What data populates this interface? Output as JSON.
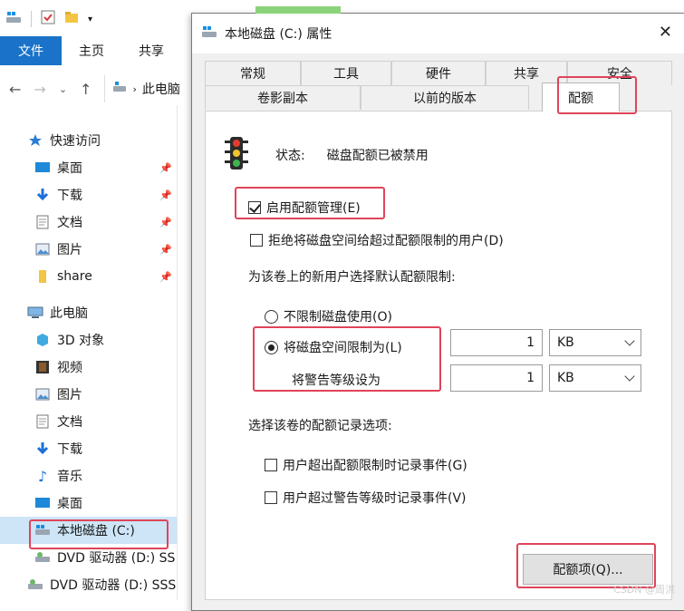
{
  "explorer": {
    "ribbon_tabs": {
      "file": "文件",
      "home": "主页",
      "share": "共享"
    },
    "address": {
      "path": "此电脑"
    },
    "nav": {
      "quick_access": "快速访问",
      "pinned": [
        "桌面",
        "下载",
        "文档",
        "图片",
        "share"
      ],
      "this_pc": "此电脑",
      "pc_items": [
        "3D 对象",
        "视频",
        "图片",
        "文档",
        "下载",
        "音乐",
        "桌面",
        "本地磁盘 (C:)",
        "DVD 驱动器 (D:) SS",
        "DVD 驱动器 (D:) SSS"
      ]
    }
  },
  "dialog": {
    "title": "本地磁盘 (C:) 属性",
    "tabs_row1": [
      "常规",
      "工具",
      "硬件",
      "共享",
      "安全"
    ],
    "tabs_row2": [
      "卷影副本",
      "以前的版本",
      "配额"
    ],
    "status_label": "状态:",
    "status_value": "磁盘配额已被禁用",
    "enable_quota": "启用配额管理(E)",
    "deny_space": "拒绝将磁盘空间给超过配额限制的用户(D)",
    "default_limit_title": "为该卷上的新用户选择默认配额限制:",
    "no_limit": "不限制磁盘使用(O)",
    "limit_to": "将磁盘空间限制为(L)",
    "warning_level": "将警告等级设为",
    "limit_value": "1",
    "limit_unit": "KB",
    "warning_value": "1",
    "warning_unit": "KB",
    "log_options_title": "选择该卷的配额记录选项:",
    "log_exceed_limit": "用户超出配额限制时记录事件(G)",
    "log_exceed_warning": "用户超过警告等级时记录事件(V)",
    "quota_entries_button": "配额项(Q)..."
  },
  "watermark": "CSDN @周洪",
  "colors": {
    "highlight": "#e0445a",
    "ribbon_file": "#1a73c8",
    "selected_nav": "#cde5f7"
  }
}
